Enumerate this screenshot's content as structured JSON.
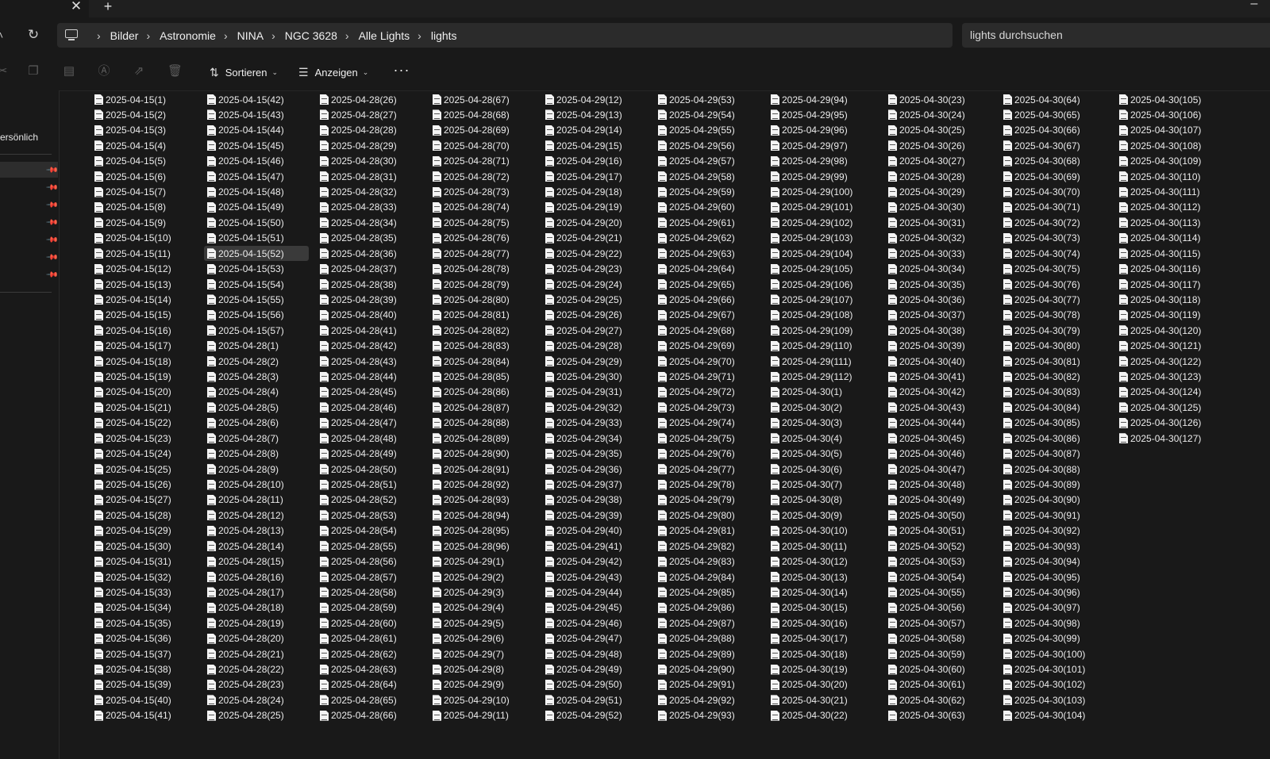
{
  "window": {
    "tab_close": "✕",
    "tab_new": "+",
    "minimize": "–"
  },
  "address": {
    "breadcrumbs": [
      "Bilder",
      "Astronomie",
      "NINA",
      "NGC 3628",
      "Alle Lights",
      "lights"
    ],
    "search_placeholder": "lights durchsuchen"
  },
  "toolbar": {
    "sort_label": "Sortieren",
    "view_label": "Anzeigen",
    "more_label": "···"
  },
  "sidebar": {
    "section_label": "ersönlich"
  },
  "files": {
    "selected": "2025-04-15(52)",
    "groups": [
      {
        "prefix": "2025-04-15",
        "from": 1,
        "to": 57
      },
      {
        "prefix": "2025-04-28",
        "from": 1,
        "to": 96
      },
      {
        "prefix": "2025-04-29",
        "from": 1,
        "to": 112
      },
      {
        "prefix": "2025-04-30",
        "from": 1,
        "to": 127
      }
    ],
    "rows_per_column": 41
  }
}
